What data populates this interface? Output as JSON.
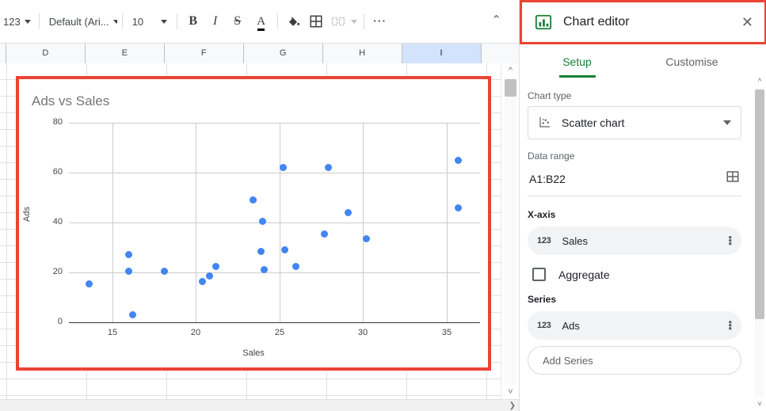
{
  "toolbar": {
    "number_format_label": "123",
    "font_label": "Default (Ari...",
    "font_size_label": "10",
    "bold_label": "B",
    "italic_label": "I",
    "strikethrough_label": "S",
    "text_color_label": "A",
    "fill_color_icon": "paint-bucket-icon",
    "borders_icon": "borders-icon",
    "merge_icon": "merge-cells-icon",
    "more_label": "⋯",
    "collapse_label": "⌃"
  },
  "sheet": {
    "columns": [
      "D",
      "E",
      "F",
      "G",
      "H",
      "I"
    ],
    "selected_column": "I"
  },
  "chart_data": {
    "type": "scatter",
    "title": "Ads vs Sales",
    "xlabel": "Sales",
    "ylabel": "Ads",
    "xlim": [
      12.4,
      37.0
    ],
    "ylim": [
      0,
      80
    ],
    "x_ticks": [
      15,
      20,
      25,
      30,
      35
    ],
    "y_ticks": [
      0,
      20,
      40,
      60,
      80
    ],
    "grid": true,
    "legend": "none",
    "point_color": "#4285f4",
    "series": [
      {
        "name": "Ads",
        "points": [
          [
            13.6,
            15.5
          ],
          [
            16.0,
            27.0
          ],
          [
            16.0,
            20.5
          ],
          [
            16.2,
            3.0
          ],
          [
            18.1,
            20.5
          ],
          [
            20.4,
            16.5
          ],
          [
            20.8,
            18.5
          ],
          [
            21.2,
            22.5
          ],
          [
            23.4,
            49.0
          ],
          [
            23.9,
            28.5
          ],
          [
            24.0,
            40.5
          ],
          [
            24.1,
            21.0
          ],
          [
            25.2,
            62.0
          ],
          [
            25.3,
            29.0
          ],
          [
            26.0,
            22.5
          ],
          [
            27.9,
            62.0
          ],
          [
            27.7,
            35.5
          ],
          [
            29.1,
            44.0
          ],
          [
            30.2,
            33.5
          ],
          [
            35.7,
            65.0
          ],
          [
            35.7,
            46.0
          ]
        ]
      }
    ]
  },
  "panel": {
    "title": "Chart editor",
    "icon": "bar-chart-icon",
    "close_label": "✕",
    "tabs": [
      {
        "label": "Setup",
        "active": true
      },
      {
        "label": "Customise",
        "active": false
      }
    ],
    "chart_type": {
      "label": "Chart type",
      "value": "Scatter chart",
      "icon": "scatter-chart-icon"
    },
    "data_range": {
      "label": "Data range",
      "value": "A1:B22",
      "picker_icon": "grid-select-icon"
    },
    "x_axis": {
      "label": "X-axis",
      "chip": {
        "type_icon": "123",
        "name": "Sales",
        "menu_icon": "kebab-menu-icon"
      },
      "aggregate": {
        "label": "Aggregate",
        "checked": false
      }
    },
    "series_section": {
      "label": "Series",
      "chips": [
        {
          "type_icon": "123",
          "name": "Ads",
          "menu_icon": "kebab-menu-icon"
        }
      ],
      "add_label": "Add Series"
    }
  },
  "colors": {
    "highlight_red": "#ea4335",
    "accent_green": "#188038",
    "point_blue": "#4285f4"
  }
}
